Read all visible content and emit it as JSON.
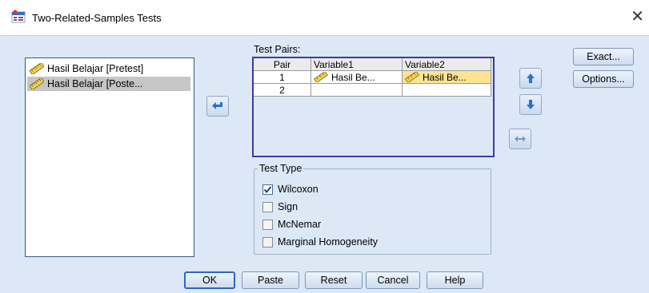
{
  "window": {
    "title": "Two-Related-Samples Tests",
    "close_glyph": "✕"
  },
  "variables": [
    {
      "label": "Hasil Belajar [Pretest]",
      "selected": false
    },
    {
      "label": "Hasil Belajar [Poste...",
      "selected": true
    }
  ],
  "test_pairs": {
    "label": "Test Pairs:",
    "columns": [
      "Pair",
      "Variable1",
      "Variable2"
    ],
    "rows": [
      {
        "pair": "1",
        "variable1": "Hasil Be...",
        "variable2": "Hasil Be..."
      },
      {
        "pair": "2",
        "variable1": "",
        "variable2": ""
      }
    ]
  },
  "test_type": {
    "label": "Test Type",
    "options": [
      {
        "label": "Wilcoxon",
        "checked": true
      },
      {
        "label": "Sign",
        "checked": false
      },
      {
        "label": "McNemar",
        "checked": false
      },
      {
        "label": "Marginal Homogeneity",
        "checked": false
      }
    ]
  },
  "side_buttons": {
    "exact": "Exact...",
    "options": "Options..."
  },
  "bottom_buttons": {
    "ok": "OK",
    "paste": "Paste",
    "reset": "Reset",
    "cancel": "Cancel",
    "help": "Help"
  },
  "icons": {
    "move": "move-right-arrow-icon",
    "up": "arrow-up-icon",
    "down": "arrow-down-icon",
    "swap": "swap-icon",
    "variable": "scale-variable-ruler-icon",
    "app": "spss-dialog-icon"
  },
  "colors": {
    "accent_arrow": "#2a73c7",
    "highlight_cell": "#ffe391",
    "selected_item": "#c6c6c6"
  }
}
